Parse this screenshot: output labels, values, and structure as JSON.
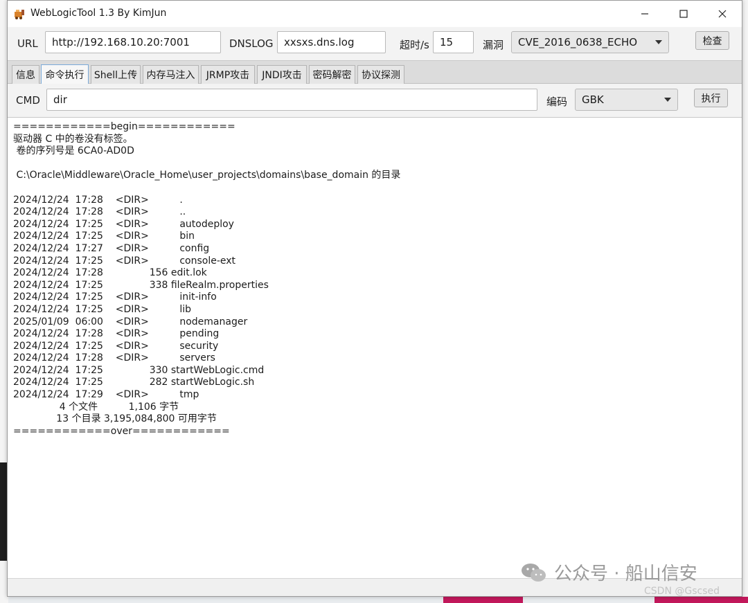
{
  "window": {
    "title": "WebLogicTool 1.3 By KimJun",
    "controls": {
      "minimize": "—",
      "maximize": "☐",
      "close": "✕"
    }
  },
  "toolbar": {
    "url_label": "URL",
    "url_value": "http://192.168.10.20:7001",
    "dnslog_label": "DNSLOG",
    "dnslog_value": "xxsxs.dns.log",
    "timeout_label": "超时/s",
    "timeout_value": "15",
    "vuln_label": "漏洞",
    "vuln_value": "CVE_2016_0638_ECHO",
    "check_button": "检查"
  },
  "tabs": [
    {
      "label": "信息",
      "active": false
    },
    {
      "label": "命令执行",
      "active": true
    },
    {
      "label": "Shell上传",
      "active": false
    },
    {
      "label": "内存马注入",
      "active": false
    },
    {
      "label": "JRMP攻击",
      "active": false
    },
    {
      "label": "JNDI攻击",
      "active": false
    },
    {
      "label": "密码解密",
      "active": false
    },
    {
      "label": "协议探测",
      "active": false
    }
  ],
  "cmd": {
    "label": "CMD",
    "value": "dir",
    "encoding_label": "编码",
    "encoding_value": "GBK",
    "run_button": "执行"
  },
  "output": {
    "lines": [
      "============begin============",
      "驱动器 C 中的卷没有标签。",
      " 卷的序列号是 6CA0-AD0D",
      "",
      " C:\\Oracle\\Middleware\\Oracle_Home\\user_projects\\domains\\base_domain 的目录",
      "",
      "2024/12/24  17:28    <DIR>          .",
      "2024/12/24  17:28    <DIR>          ..",
      "2024/12/24  17:25    <DIR>          autodeploy",
      "2024/12/24  17:25    <DIR>          bin",
      "2024/12/24  17:27    <DIR>          config",
      "2024/12/24  17:25    <DIR>          console-ext",
      "2024/12/24  17:28               156 edit.lok",
      "2024/12/24  17:25               338 fileRealm.properties",
      "2024/12/24  17:25    <DIR>          init-info",
      "2024/12/24  17:25    <DIR>          lib",
      "2025/01/09  06:00    <DIR>          nodemanager",
      "2024/12/24  17:28    <DIR>          pending",
      "2024/12/24  17:25    <DIR>          security",
      "2024/12/24  17:28    <DIR>          servers",
      "2024/12/24  17:25               330 startWebLogic.cmd",
      "2024/12/24  17:25               282 startWebLogic.sh",
      "2024/12/24  17:29    <DIR>          tmp",
      "               4 个文件          1,106 字节",
      "              13 个目录 3,195,084,800 可用字节",
      "============over============"
    ]
  },
  "watermark": {
    "text": "公众号 · 船山信安",
    "csdn": "CSDN @Gscsed"
  }
}
